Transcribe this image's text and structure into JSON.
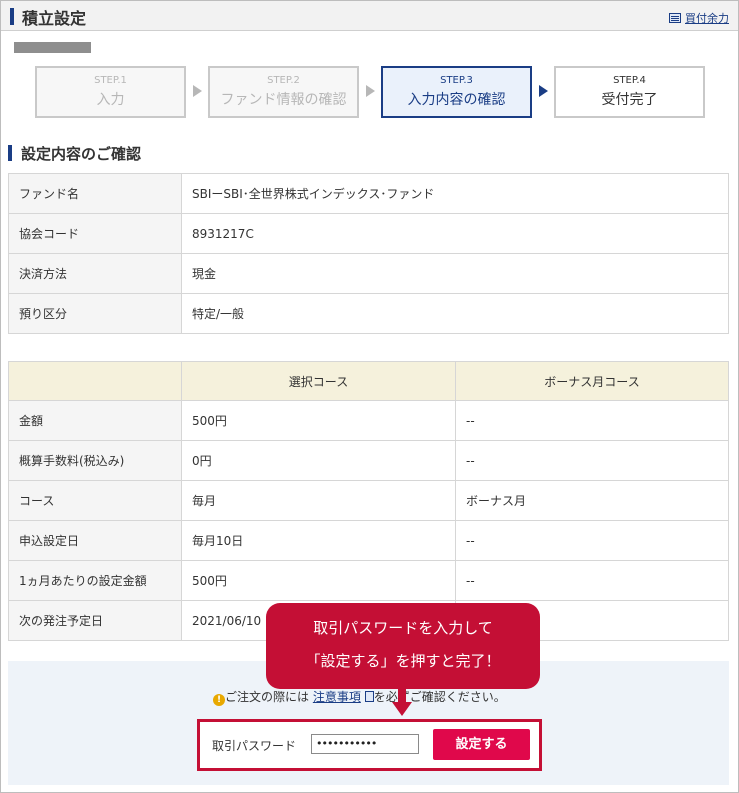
{
  "header": {
    "title": "積立設定",
    "link": "買付余力"
  },
  "steps": [
    {
      "num": "STEP.1",
      "label": "入力"
    },
    {
      "num": "STEP.2",
      "label": "ファンド情報の確認"
    },
    {
      "num": "STEP.3",
      "label": "入力内容の確認"
    },
    {
      "num": "STEP.4",
      "label": "受付完了"
    }
  ],
  "section_title": "設定内容のご確認",
  "fund_info": [
    {
      "key": "ファンド名",
      "value": "SBIーSBI･全世界株式インデックス･ファンド"
    },
    {
      "key": "協会コード",
      "value": "8931217C"
    },
    {
      "key": "決済方法",
      "value": "現金"
    },
    {
      "key": "預り区分",
      "value": "特定/一般"
    }
  ],
  "course_table": {
    "headers": [
      "",
      "選択コース",
      "ボーナス月コース"
    ],
    "rows": [
      [
        "金額",
        "500円",
        "--"
      ],
      [
        "概算手数料(税込み)",
        "0円",
        "--"
      ],
      [
        "コース",
        "毎月",
        "ボーナス月"
      ],
      [
        "申込設定日",
        "毎月10日",
        "--"
      ],
      [
        "1ヵ月あたりの設定金額",
        "500円",
        "--"
      ],
      [
        "次の発注予定日",
        "2021/06/10",
        ""
      ]
    ]
  },
  "notice": {
    "icon": "!",
    "prefix": "ご注文の際には",
    "link": "注意事項",
    "suffix": "を必ずご確認ください。"
  },
  "password": {
    "label": "取引パスワード",
    "value": "•••••••••••",
    "submit": "設定する"
  },
  "callout": {
    "line1": "取引パスワードを入力して",
    "line2": "「設定する」を押すと完了！"
  },
  "colors": {
    "brand": "#1a3d85",
    "accent": "#c40f35",
    "button": "#e0084b"
  }
}
